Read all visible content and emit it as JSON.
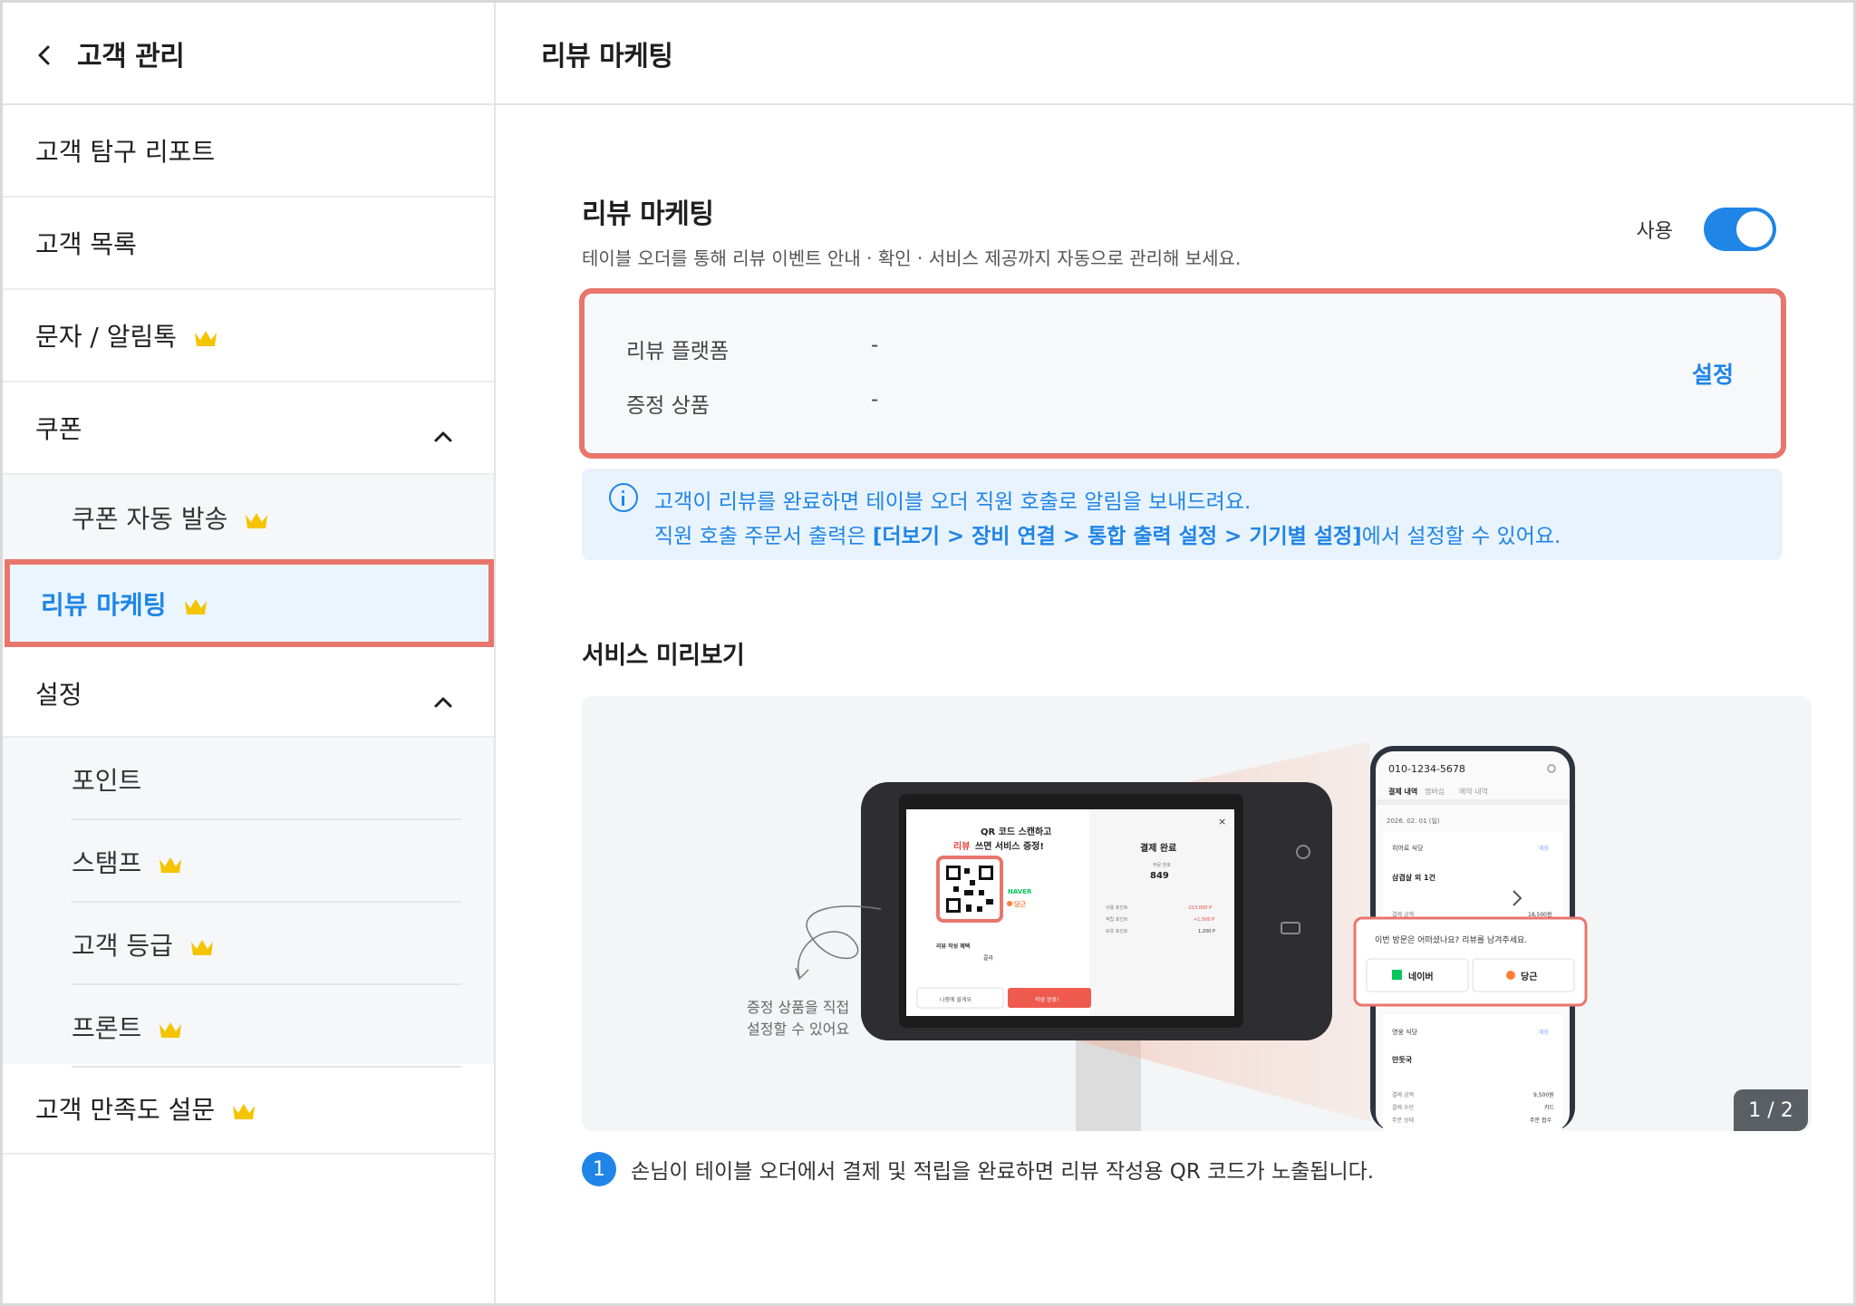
{
  "sidebar": {
    "title": "고객 관리",
    "items": [
      {
        "label": "고객 탐구 리포트"
      },
      {
        "label": "고객 목록"
      },
      {
        "label": "문자 / 알림톡"
      },
      {
        "label": "쿠폰"
      },
      {
        "label": "쿠폰 자동 발송"
      },
      {
        "label": "리뷰 마케팅"
      },
      {
        "label": "설정"
      },
      {
        "label": "포인트"
      },
      {
        "label": "스탬프"
      },
      {
        "label": "고객 등급"
      },
      {
        "label": "프론트"
      },
      {
        "label": "고객 만족도 설문"
      }
    ]
  },
  "header": {
    "title": "리뷰 마케팅"
  },
  "review": {
    "title": "리뷰 마케팅",
    "description": "테이블 오더를 통해 리뷰 이벤트 안내 · 확인 · 서비스 제공까지 자동으로 관리해 보세요.",
    "toggle_label": "사용",
    "enabled": true,
    "platform_label": "리뷰 플랫폼",
    "platform_value": "-",
    "gift_label": "증정 상품",
    "gift_value": "-",
    "settings_button": "설정"
  },
  "info": {
    "line1": "고객이 리뷰를 완료하면 테이블 오더 직원 호출로 알림을 보내드려요.",
    "line2_prefix": "직원 호출 주문서 출력은 ",
    "line2_bold": "[더보기 > 장비 연결 > 통합 출력 설정 > 기기별 설정]",
    "line2_suffix": "에서 설정할 수 있어요."
  },
  "preview": {
    "title": "서비스 미리보기",
    "page_indicator": "1 / 2",
    "annotation_line1": "증정 상품을 직접",
    "annotation_line2": "설정할 수 있어요",
    "tablet": {
      "qr_title_1": "QR 코드 스캔하고",
      "qr_title_2_red": "리뷰",
      "qr_title_2_rest": " 쓰면 서비스 증정!",
      "naver": "NAVER",
      "danggeun": "당근",
      "payment_done": "결제 완료",
      "order_number_label": "주문 번호",
      "order_number": "849",
      "benefit_label": "리뷰 작성 혜택",
      "benefit_value": "콜라",
      "later_button": "나중에 쓸게요",
      "done_button": "작성 완료!",
      "close": "×",
      "summary_rows": [
        {
          "label": "사용 포인트",
          "value": "-213,000 P"
        },
        {
          "label": "적립 포인트",
          "value": "+1,500 P"
        },
        {
          "label": "보유 포인트",
          "value": "1,200 P"
        }
      ]
    },
    "phone": {
      "phone_number": "010-1234-5678",
      "tabs": [
        "결제 내역",
        "멤버십",
        "예약 내역"
      ],
      "date": "2026. 02. 01 (일)",
      "store1": "히어로 식당",
      "badge1": "매장",
      "menu1": "삼겹살 외 1건",
      "pay_label": "결제 금액",
      "pay_value1": "18,500원",
      "review_prompt": "이번 방문은 어떠셨나요? 리뷰를 남겨주세요.",
      "naver_button": "네이버",
      "danggeun_button": "당근",
      "store2": "영웅 식당",
      "badge2": "매장",
      "menu2": "만둣국",
      "pay_value2": "9,500원",
      "method_label": "결제 수단",
      "method_value": "카드",
      "status_label": "주문 상태",
      "status_value": "주문 접수"
    }
  },
  "step": {
    "number": "1",
    "text": "손님이 테이블 오더에서 결제 및 적립을 완료하면 리뷰 작성용 QR 코드가 노출됩니다."
  },
  "colors": {
    "accent": "#1f85e6",
    "highlight": "#e8766c",
    "crown": "#f5c400"
  }
}
